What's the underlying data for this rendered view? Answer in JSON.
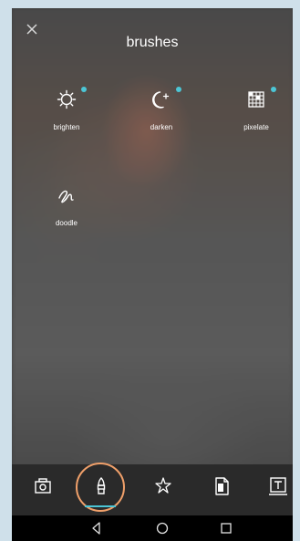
{
  "header": {
    "title": "brushes"
  },
  "brushes": [
    {
      "label": "brighten",
      "icon": "sun-gear-icon",
      "has_dot": true
    },
    {
      "label": "darken",
      "icon": "moon-sparkle-icon",
      "has_dot": true
    },
    {
      "label": "pixelate",
      "icon": "pixel-grid-icon",
      "has_dot": true
    },
    {
      "label": "doodle",
      "icon": "squiggle-icon",
      "has_dot": false
    }
  ],
  "toolbar": {
    "tools": [
      "camera-frame-icon",
      "brush-icon",
      "sparkle-star-icon",
      "document-icon",
      "text-frame-icon"
    ],
    "active_tool": "brush-icon",
    "accent_color": "#4cc6d6",
    "highlight_color": "#f0a06a"
  },
  "android_nav": {
    "buttons": [
      "back-icon",
      "home-icon",
      "recents-icon"
    ]
  }
}
